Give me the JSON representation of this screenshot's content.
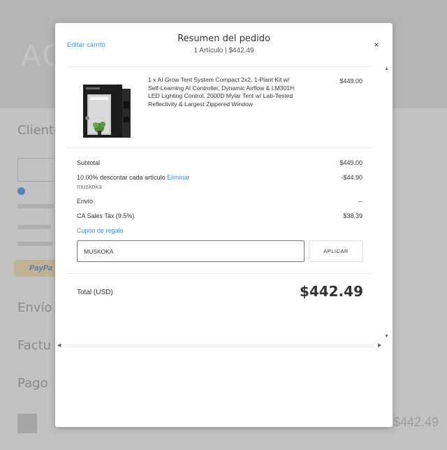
{
  "background": {
    "logo_text": "AC",
    "sections": [
      "Cliente",
      "Envío",
      "Factu",
      "Pago"
    ],
    "paypal_label": "PayPa",
    "footer_total": "$442.49"
  },
  "modal": {
    "edit_cart_label": "Editar carrito",
    "title": "Resumen del pedido",
    "subtitle": "1 Artículo | $442.49",
    "close_label": "×",
    "product": {
      "description": "1 x AI Grow Tent System Compact 2x2, 1-Plant Kit w/ Self-Learning AI Controller, Dynamic Airflow & LM301H LED Lighting Control, 2000D Mylar Tent w/ Lab-Tested Reflectivity & Largest Zippered Window",
      "price": "$449.00"
    },
    "subtotal": {
      "label": "Subtotal",
      "value": "$449.00"
    },
    "discount": {
      "label": "10.00% descontar cada artículo",
      "remove_label": "Eliminar",
      "code": "muskoka",
      "value": "-$44.90"
    },
    "shipping": {
      "label": "Envío",
      "value": "--"
    },
    "tax": {
      "label": "CA Sales Tax (9.5%)",
      "value": "$38.39"
    },
    "gift_coupon_label": "Cupón de regalo",
    "coupon_input_value": "MUSKOKA",
    "apply_button_label": "APLICAR",
    "total": {
      "label": "Total (USD)",
      "value": "$442.49"
    }
  },
  "colors": {
    "link": "#3f8ddc",
    "overlay": "rgba(120,120,120,0.45)"
  }
}
